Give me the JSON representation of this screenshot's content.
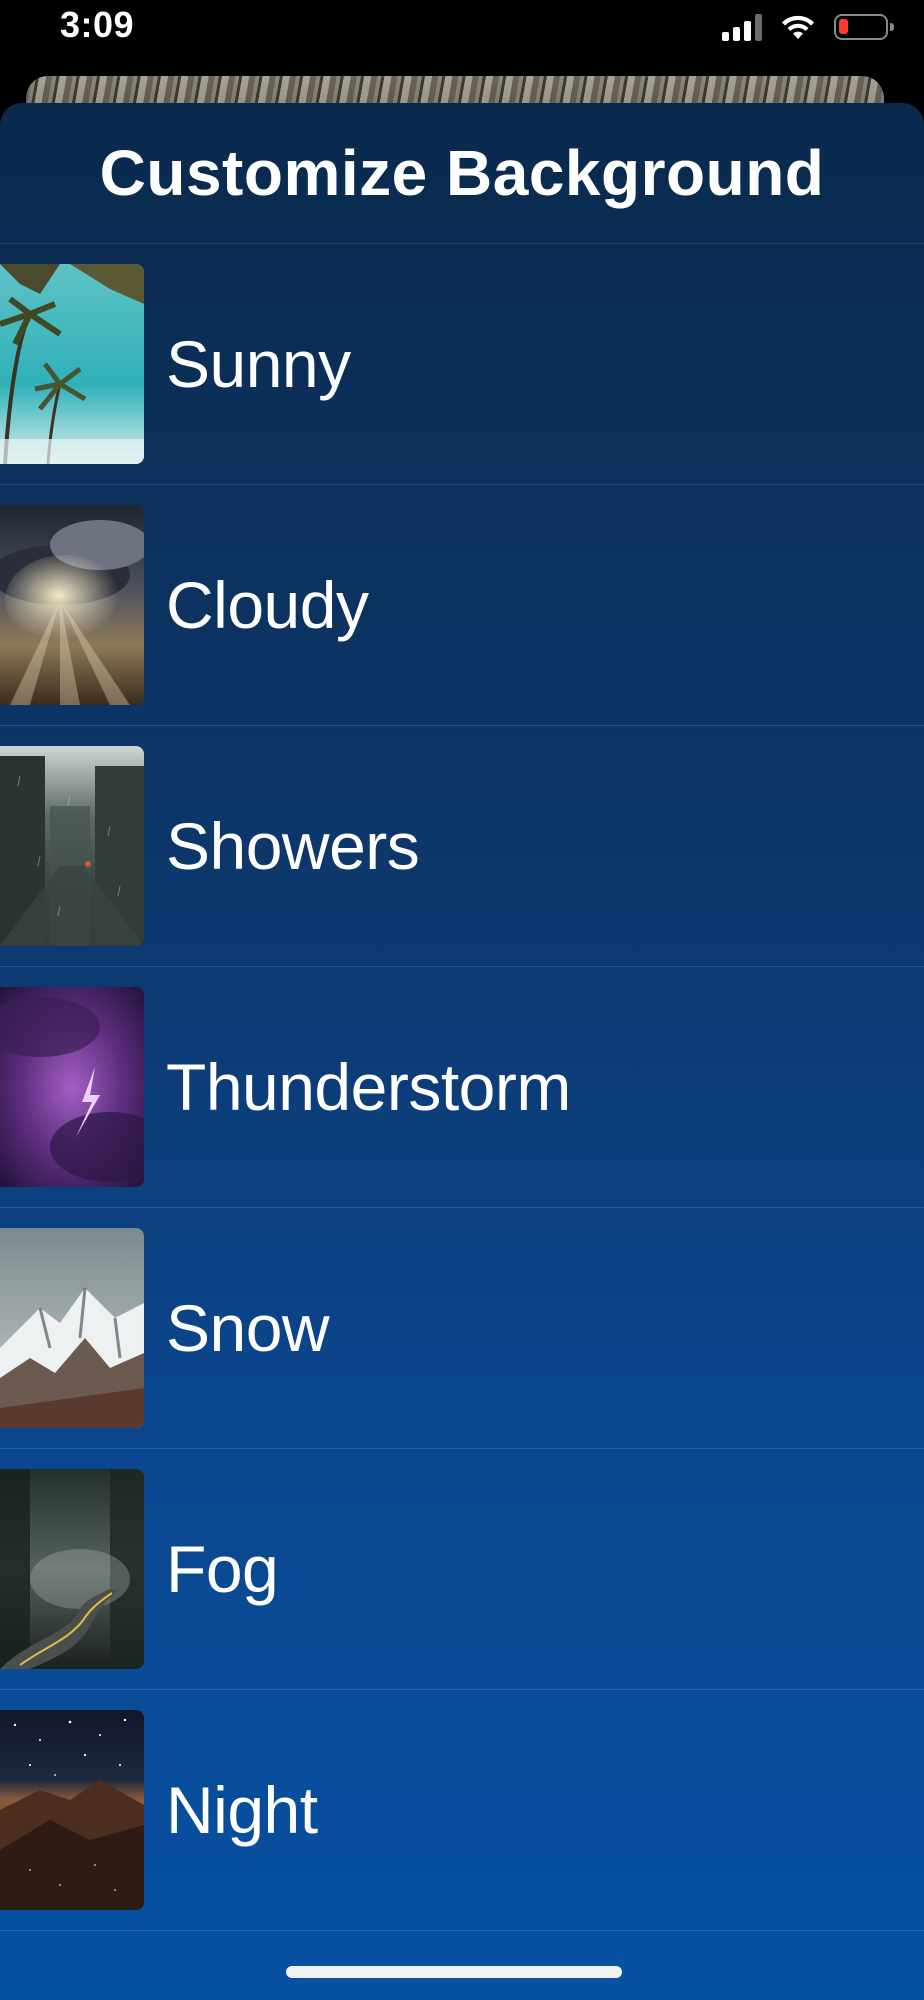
{
  "status_bar": {
    "time": "3:09",
    "icons": [
      "cellular-signal-icon",
      "wifi-icon",
      "battery-low-icon"
    ],
    "battery_color": "#ff3b30"
  },
  "sheet": {
    "title": "Customize Background",
    "background_top": "#0a2a4d",
    "background_bottom": "#0751a3"
  },
  "backgrounds": [
    {
      "label": "Sunny",
      "thumbnail": "palm-trees-sky-thumbnail"
    },
    {
      "label": "Cloudy",
      "thumbnail": "sunrays-through-clouds-thumbnail"
    },
    {
      "label": "Showers",
      "thumbnail": "rainy-city-street-thumbnail"
    },
    {
      "label": "Thunderstorm",
      "thumbnail": "purple-lightning-storm-thumbnail"
    },
    {
      "label": "Snow",
      "thumbnail": "snowy-mountains-thumbnail"
    },
    {
      "label": "Fog",
      "thumbnail": "foggy-forest-road-thumbnail"
    },
    {
      "label": "Night",
      "thumbnail": "starry-night-mountain-thumbnail"
    }
  ]
}
